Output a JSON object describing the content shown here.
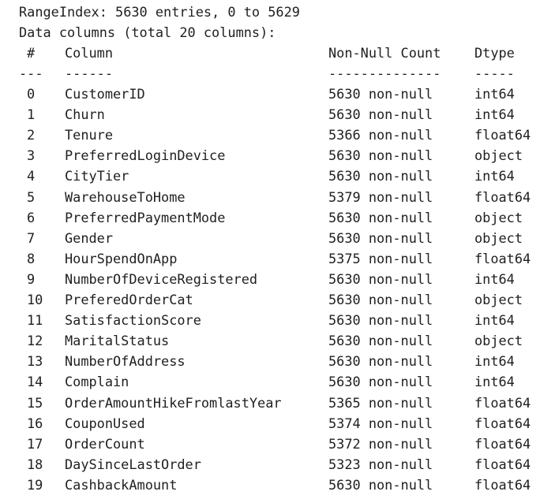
{
  "range_index": "RangeIndex: 5630 entries, 0 to 5629",
  "data_columns": "Data columns (total 20 columns):",
  "header": {
    "index": "#",
    "column": "Column",
    "non_null_count": "Non-Null Count",
    "dtype": "Dtype"
  },
  "separator": {
    "index": "---",
    "column": "------",
    "non_null_count": "--------------",
    "dtype": "-----"
  },
  "rows": [
    {
      "index": "0",
      "column": "CustomerID",
      "non_null": "5630 non-null",
      "dtype": "int64"
    },
    {
      "index": "1",
      "column": "Churn",
      "non_null": "5630 non-null",
      "dtype": "int64"
    },
    {
      "index": "2",
      "column": "Tenure",
      "non_null": "5366 non-null",
      "dtype": "float64"
    },
    {
      "index": "3",
      "column": "PreferredLoginDevice",
      "non_null": "5630 non-null",
      "dtype": "object"
    },
    {
      "index": "4",
      "column": "CityTier",
      "non_null": "5630 non-null",
      "dtype": "int64"
    },
    {
      "index": "5",
      "column": "WarehouseToHome",
      "non_null": "5379 non-null",
      "dtype": "float64"
    },
    {
      "index": "6",
      "column": "PreferredPaymentMode",
      "non_null": "5630 non-null",
      "dtype": "object"
    },
    {
      "index": "7",
      "column": "Gender",
      "non_null": "5630 non-null",
      "dtype": "object"
    },
    {
      "index": "8",
      "column": "HourSpendOnApp",
      "non_null": "5375 non-null",
      "dtype": "float64"
    },
    {
      "index": "9",
      "column": "NumberOfDeviceRegistered",
      "non_null": "5630 non-null",
      "dtype": "int64"
    },
    {
      "index": "10",
      "column": "PreferedOrderCat",
      "non_null": "5630 non-null",
      "dtype": "object"
    },
    {
      "index": "11",
      "column": "SatisfactionScore",
      "non_null": "5630 non-null",
      "dtype": "int64"
    },
    {
      "index": "12",
      "column": "MaritalStatus",
      "non_null": "5630 non-null",
      "dtype": "object"
    },
    {
      "index": "13",
      "column": "NumberOfAddress",
      "non_null": "5630 non-null",
      "dtype": "int64"
    },
    {
      "index": "14",
      "column": "Complain",
      "non_null": "5630 non-null",
      "dtype": "int64"
    },
    {
      "index": "15",
      "column": "OrderAmountHikeFromlastYear",
      "non_null": "5365 non-null",
      "dtype": "float64"
    },
    {
      "index": "16",
      "column": "CouponUsed",
      "non_null": "5374 non-null",
      "dtype": "float64"
    },
    {
      "index": "17",
      "column": "OrderCount",
      "non_null": "5372 non-null",
      "dtype": "float64"
    },
    {
      "index": "18",
      "column": "DaySinceLastOrder",
      "non_null": "5323 non-null",
      "dtype": "float64"
    },
    {
      "index": "19",
      "column": "CashbackAmount",
      "non_null": "5630 non-null",
      "dtype": "float64"
    }
  ]
}
